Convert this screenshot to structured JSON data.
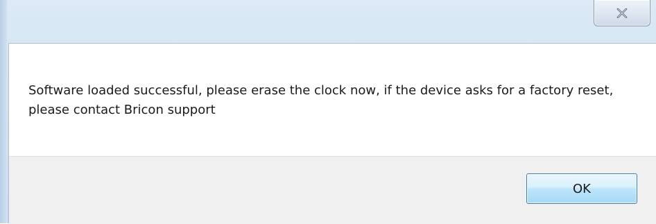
{
  "dialog": {
    "message": "Software loaded successful, please erase the clock now, if the device asks for a factory reset, please contact Bricon support",
    "ok_label": "OK",
    "close_icon": "close-icon"
  },
  "colors": {
    "frame": "#d3e4f3",
    "client_bg": "#ffffff",
    "button_bar_bg": "#f0f0f0",
    "ok_border": "#3c7fb1",
    "text": "#1a1a1a"
  }
}
